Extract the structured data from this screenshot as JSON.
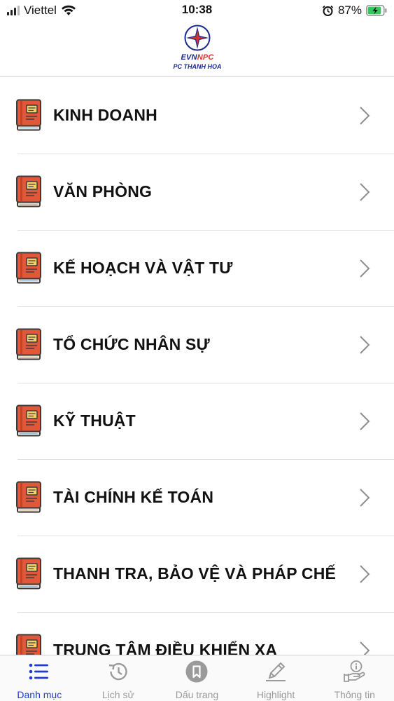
{
  "status_bar": {
    "carrier": "Viettel",
    "time": "10:38",
    "battery_percent": "87%",
    "battery_level": 0.87,
    "icons": [
      "signal-icon",
      "wifi-icon",
      "alarm-icon",
      "battery-charging-icon"
    ]
  },
  "header": {
    "logo_evn": "EVN",
    "logo_npc": "NPC",
    "logo_sub": "PC THANH HOA"
  },
  "colors": {
    "book_cover": "#e0573a",
    "book_spine": "#3b3b3b",
    "tab_active": "#1f3bd0",
    "tab_inactive": "#9a9a9a",
    "brand_blue": "#1a2a8c",
    "brand_red": "#d8342a"
  },
  "menu": {
    "items": [
      {
        "label": "KINH DOANH",
        "icon": "book-icon"
      },
      {
        "label": "VĂN PHÒNG",
        "icon": "book-icon"
      },
      {
        "label": "KẾ HOẠCH VÀ VẬT TƯ",
        "icon": "book-icon"
      },
      {
        "label": "TỔ CHỨC NHÂN SỰ",
        "icon": "book-icon"
      },
      {
        "label": "KỸ THUẬT",
        "icon": "book-icon"
      },
      {
        "label": "TÀI CHÍNH KẾ TOÁN",
        "icon": "book-icon"
      },
      {
        "label": "THANH TRA, BẢO VỆ VÀ PHÁP CHẾ",
        "icon": "book-icon"
      },
      {
        "label": "TRUNG TÂM ĐIỀU KHIỂN XA",
        "icon": "book-icon"
      }
    ]
  },
  "tab_bar": {
    "tabs": [
      {
        "label": "Danh mục",
        "icon": "list-icon",
        "active": true
      },
      {
        "label": "Lịch sử",
        "icon": "history-icon",
        "active": false
      },
      {
        "label": "Dấu trang",
        "icon": "bookmark-icon",
        "active": false
      },
      {
        "label": "Highlight",
        "icon": "pencil-icon",
        "active": false
      },
      {
        "label": "Thông tin",
        "icon": "info-hand-icon",
        "active": false
      }
    ]
  }
}
